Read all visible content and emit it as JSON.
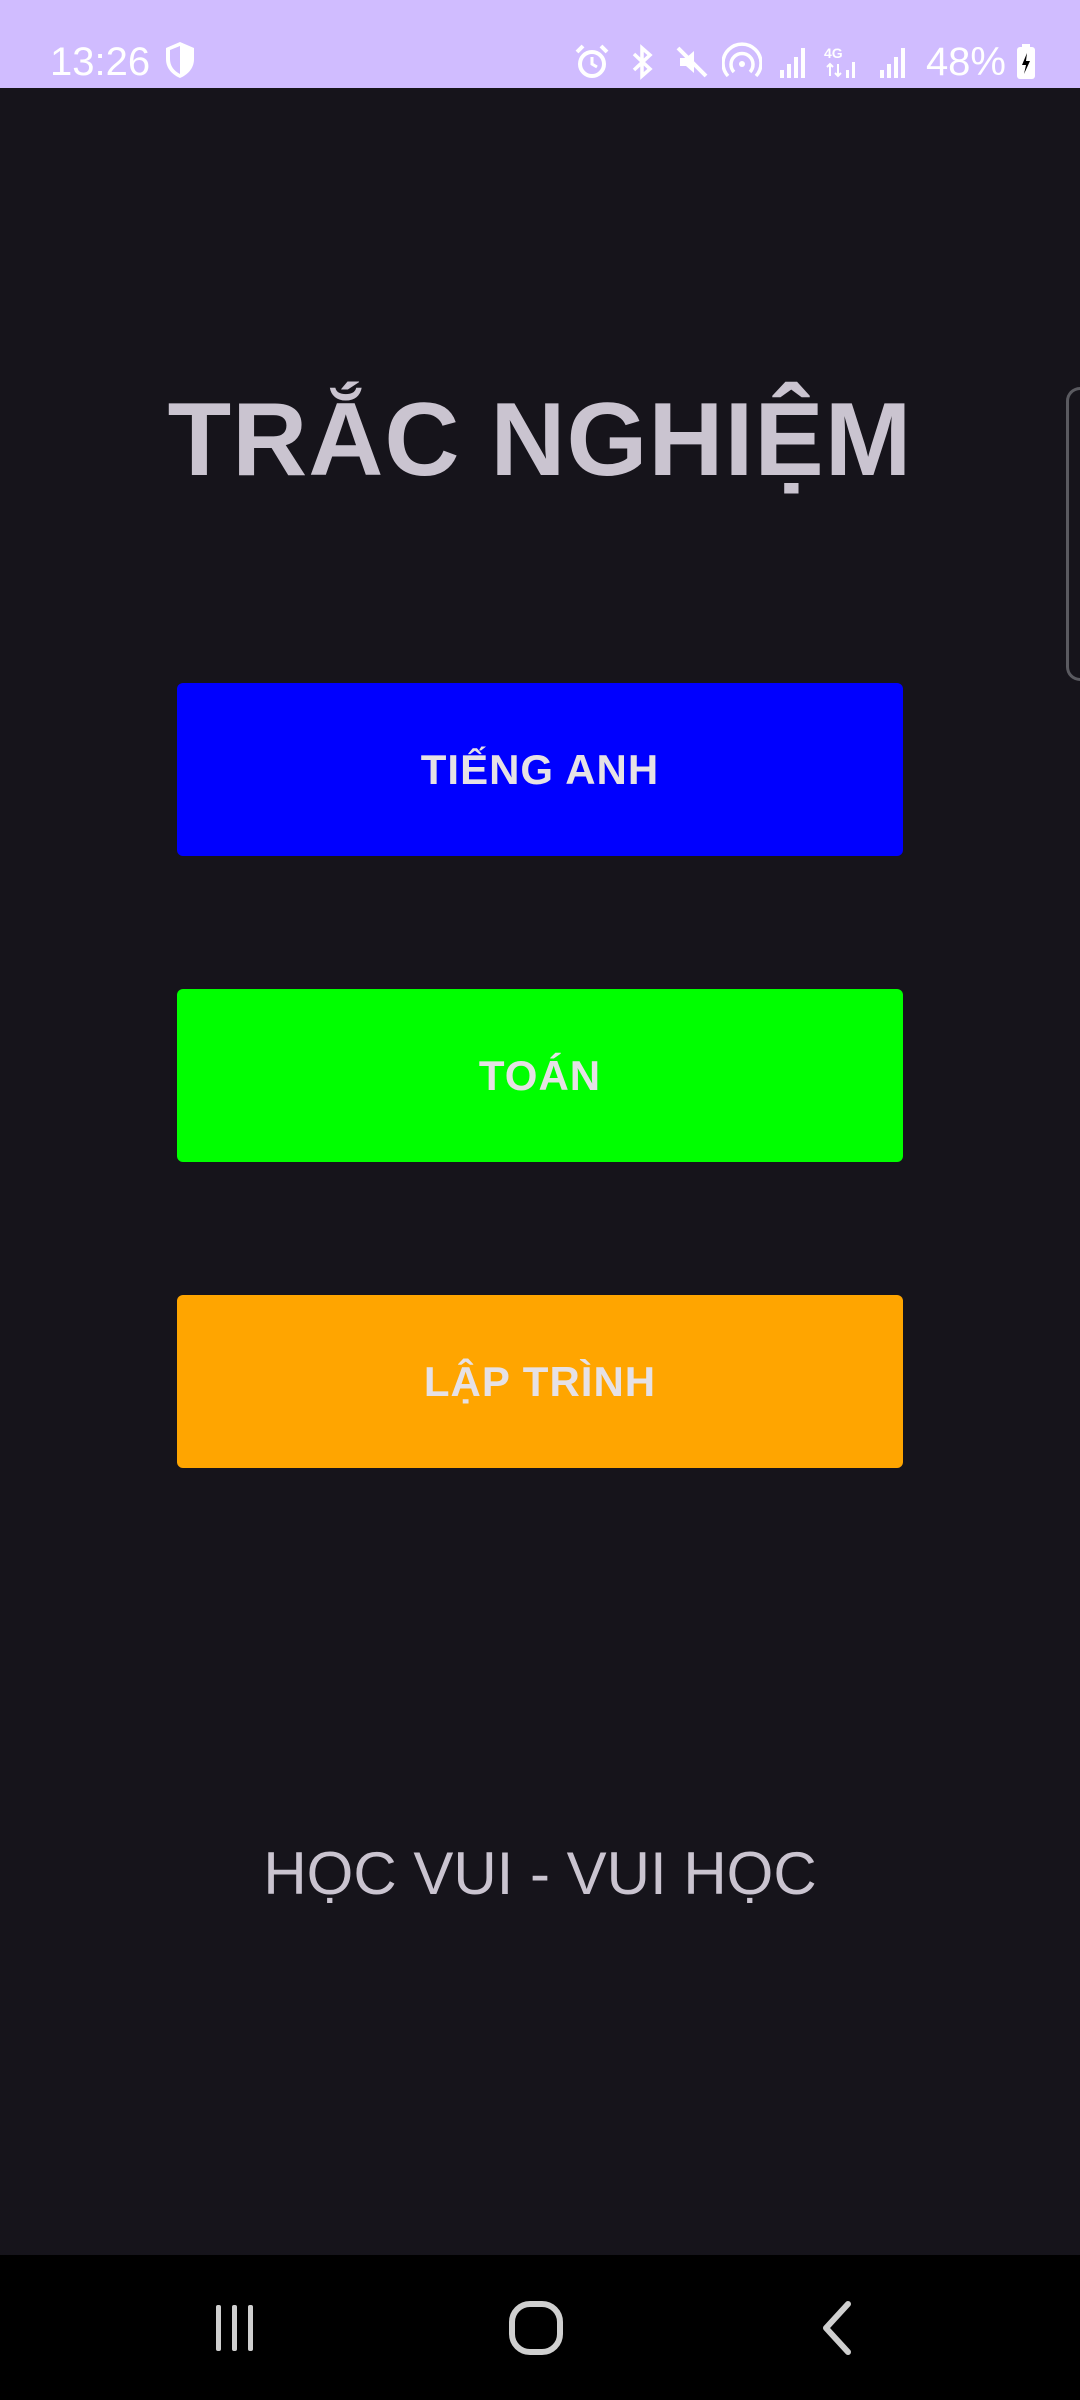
{
  "status_bar": {
    "time": "13:26",
    "battery_percent": "48%",
    "background_color": "#d0bcff",
    "icons_left": [
      "shield-icon"
    ],
    "icons_right": [
      "alarm-icon",
      "bluetooth-icon",
      "mute-icon",
      "hotspot-icon",
      "signal-icon",
      "4g-signal-icon",
      "signal-icon",
      "battery-icon"
    ]
  },
  "main": {
    "title": "TRẮC NGHIỆM",
    "buttons": [
      {
        "label": "TIẾNG ANH",
        "color": "#0000ff"
      },
      {
        "label": "TOÁN",
        "color": "#00ff00"
      },
      {
        "label": "LẬP TRÌNH",
        "color": "#ffa500"
      }
    ],
    "slogan": "HỌC VUI - VUI HỌC",
    "background_color": "#16141b"
  },
  "nav_bar": {
    "buttons": [
      "recents-icon",
      "home-icon",
      "back-icon"
    ]
  }
}
